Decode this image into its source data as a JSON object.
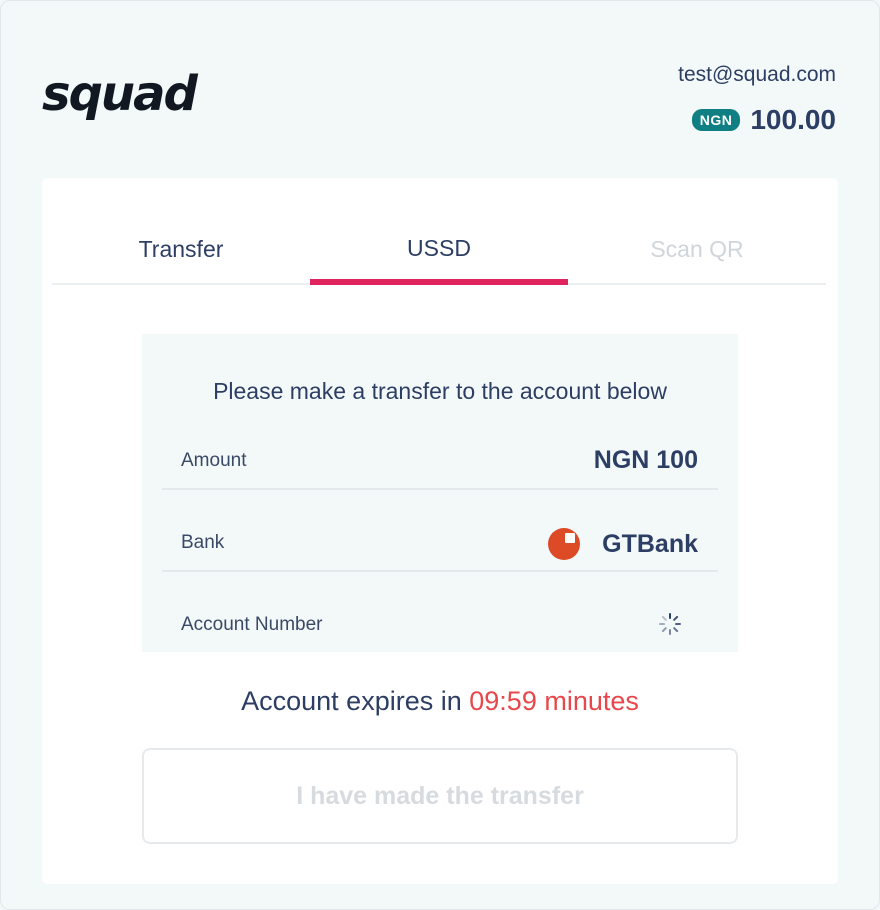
{
  "header": {
    "logo_text": "squad",
    "email": "test@squad.com",
    "currency_badge": "NGN",
    "amount": "100.00"
  },
  "tabs": [
    {
      "label": "Transfer",
      "state": "normal"
    },
    {
      "label": "USSD",
      "state": "active"
    },
    {
      "label": "Scan QR",
      "state": "disabled"
    }
  ],
  "panel": {
    "title": "Please make a transfer to the account below",
    "amount_label": "Amount",
    "amount_value": "NGN 100",
    "bank_label": "Bank",
    "bank_value": "GTBank",
    "account_label": "Account Number"
  },
  "expiry": {
    "prefix": "Account expires in",
    "time": "09:59 minutes"
  },
  "confirm_button": {
    "label": "I have made the transfer"
  },
  "colors": {
    "accent": "#e0245e",
    "badge": "#0f7f84",
    "timer": "#e8474b",
    "text": "#2c3e63"
  }
}
